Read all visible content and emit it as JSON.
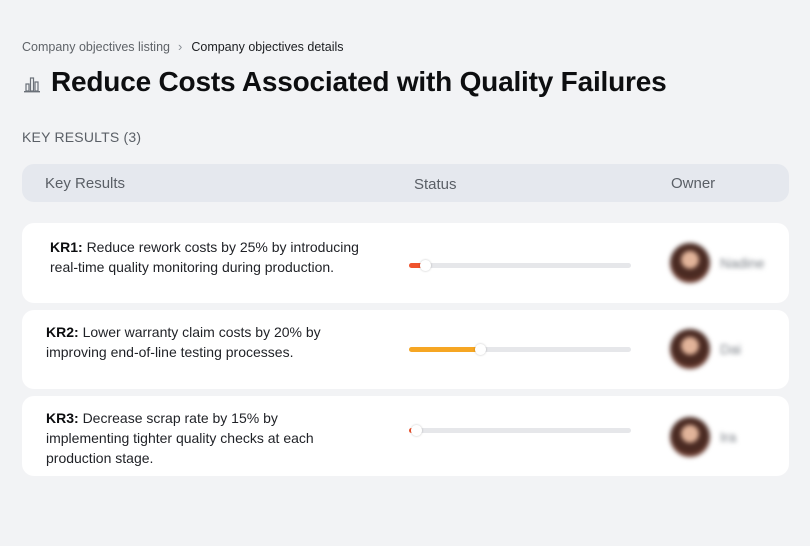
{
  "breadcrumb": {
    "parent": "Company objectives listing",
    "separator": "›",
    "current": "Company objectives details"
  },
  "page": {
    "title": "Reduce Costs Associated with Quality Failures",
    "title_icon": "bar-chart-icon"
  },
  "section": {
    "label": "KEY RESULTS (3)"
  },
  "table": {
    "headers": {
      "key_results": "Key Results",
      "status": "Status",
      "owner": "Owner"
    }
  },
  "key_results": [
    {
      "code": "KR1:",
      "text": "Reduce rework costs by 25% by introducing real-time quality monitoring during production.",
      "progress": 0.07,
      "progress_color": "#f0532d",
      "owner_name": "Nadine"
    },
    {
      "code": "KR2:",
      "text": "Lower warranty claim costs by 20% by improving end-of-line testing processes.",
      "progress": 0.32,
      "progress_color": "#f6a623",
      "owner_name": "Dai"
    },
    {
      "code": "KR3:",
      "text": "Decrease scrap rate by 15% by implementing tighter quality checks at each production stage.",
      "progress": 0.03,
      "progress_color": "#f0532d",
      "owner_name": "Ira"
    }
  ]
}
